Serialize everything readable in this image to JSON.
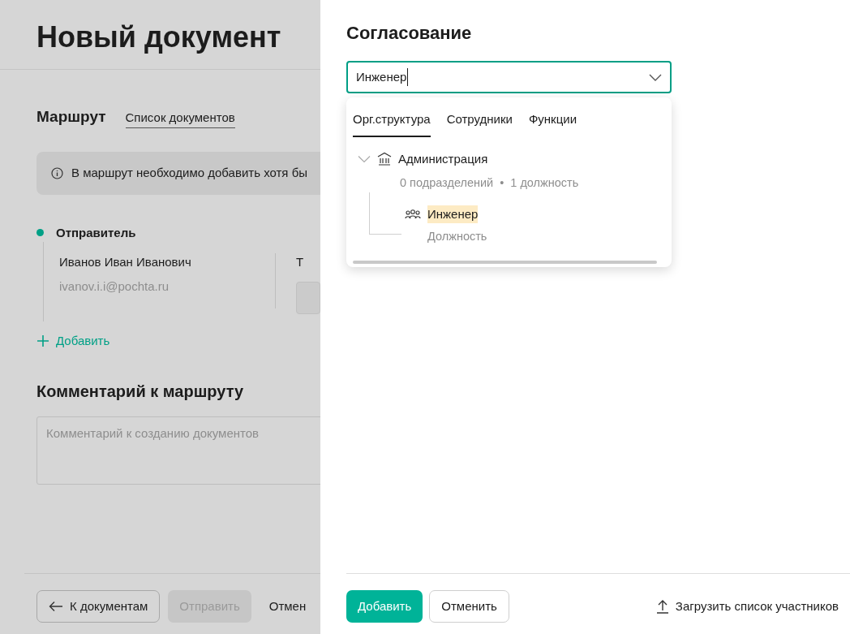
{
  "page": {
    "title": "Новый документ",
    "section_title": "Маршрут",
    "section_link": "Список документов",
    "notice": "В маршрут необходимо добавить хотя бы",
    "route": [
      {
        "role": "Отправитель",
        "name": "Иванов Иван Иванович",
        "email": "ivanov.i.i@pochta.ru",
        "column_2_label": "Т"
      }
    ],
    "add_label": "Добавить",
    "comment_title": "Комментарий к маршруту",
    "comment_placeholder": "Комментарий к созданию документов",
    "footer_buttons": [
      {
        "kind": "back",
        "label": "К документам",
        "disabled": false
      },
      {
        "kind": "primary",
        "label": "Отправить",
        "disabled": true
      },
      {
        "kind": "text",
        "label": "Отмен",
        "disabled": false
      }
    ]
  },
  "drawer": {
    "title": "Согласование",
    "select": {
      "value": "Инженер"
    },
    "dropdown": {
      "tabs": [
        {
          "label": "Орг.структура",
          "selected": true
        },
        {
          "label": "Сотрудники",
          "selected": false
        },
        {
          "label": "Функции",
          "selected": false
        }
      ],
      "tree": [
        {
          "kind": "department",
          "name": "Администрация",
          "expanded": true,
          "meta": [
            "0 подразделений",
            "1 должность"
          ],
          "meta_separator": "•",
          "highlighted": false,
          "children": [
            {
              "kind": "position",
              "name": "Инженер",
              "subtitle": "Должность",
              "highlighted": true
            }
          ]
        }
      ]
    },
    "buttons": [
      {
        "kind": "primary",
        "label": "Добавить"
      },
      {
        "kind": "outline",
        "label": "Отменить"
      }
    ],
    "upload_label": "Загрузить список участников"
  }
}
